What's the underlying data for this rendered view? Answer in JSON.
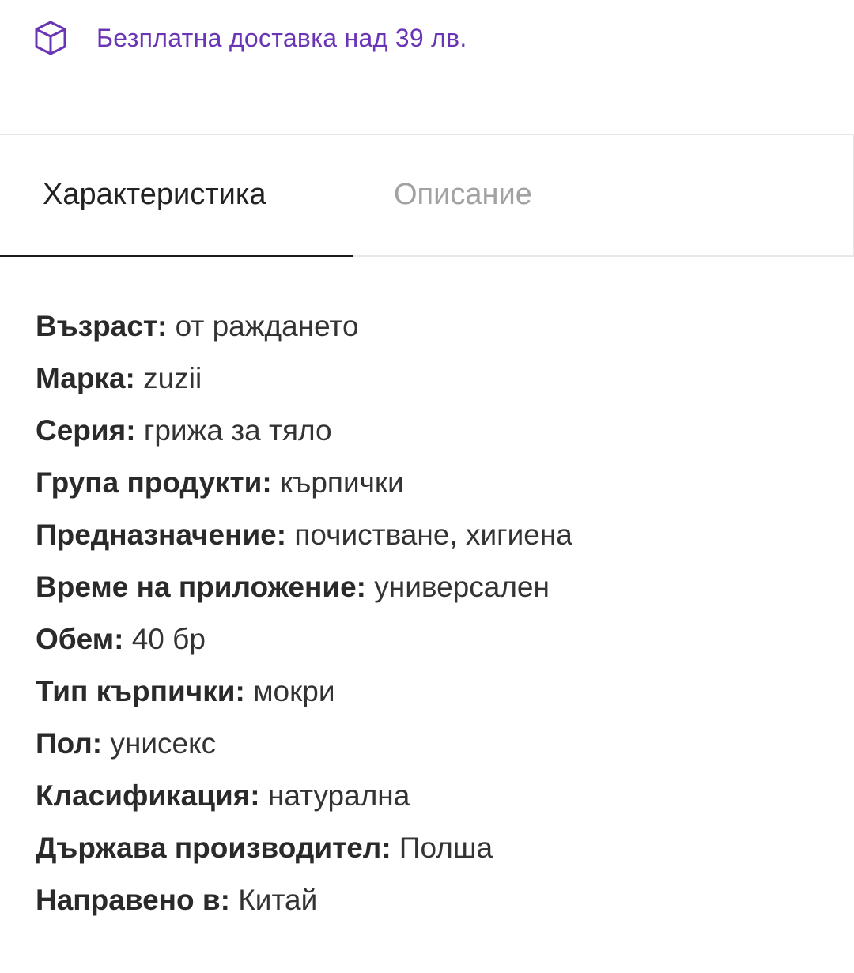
{
  "shipping": {
    "icon": "box-icon",
    "text": "Безплатна доставка над 39 лв.",
    "color": "#6a35b4"
  },
  "tabs": [
    {
      "label": "Характеристика",
      "active": true
    },
    {
      "label": "Описание",
      "active": false
    }
  ],
  "specs": [
    {
      "label": "Възраст:",
      "value": "от раждането"
    },
    {
      "label": "Марка:",
      "value": "zuzii"
    },
    {
      "label": "Серия:",
      "value": "грижа за тяло"
    },
    {
      "label": "Група продукти:",
      "value": "кърпички"
    },
    {
      "label": "Предназначение:",
      "value": "почистване, хигиена"
    },
    {
      "label": "Време на приложение:",
      "value": "универсален"
    },
    {
      "label": "Обем:",
      "value": "40 бр"
    },
    {
      "label": "Тип кърпички:",
      "value": "мокри"
    },
    {
      "label": "Пол:",
      "value": "унисекс"
    },
    {
      "label": "Класификация:",
      "value": "натурална"
    },
    {
      "label": "Държава производител:",
      "value": "Полша"
    },
    {
      "label": "Направено в:",
      "value": "Китай"
    }
  ]
}
